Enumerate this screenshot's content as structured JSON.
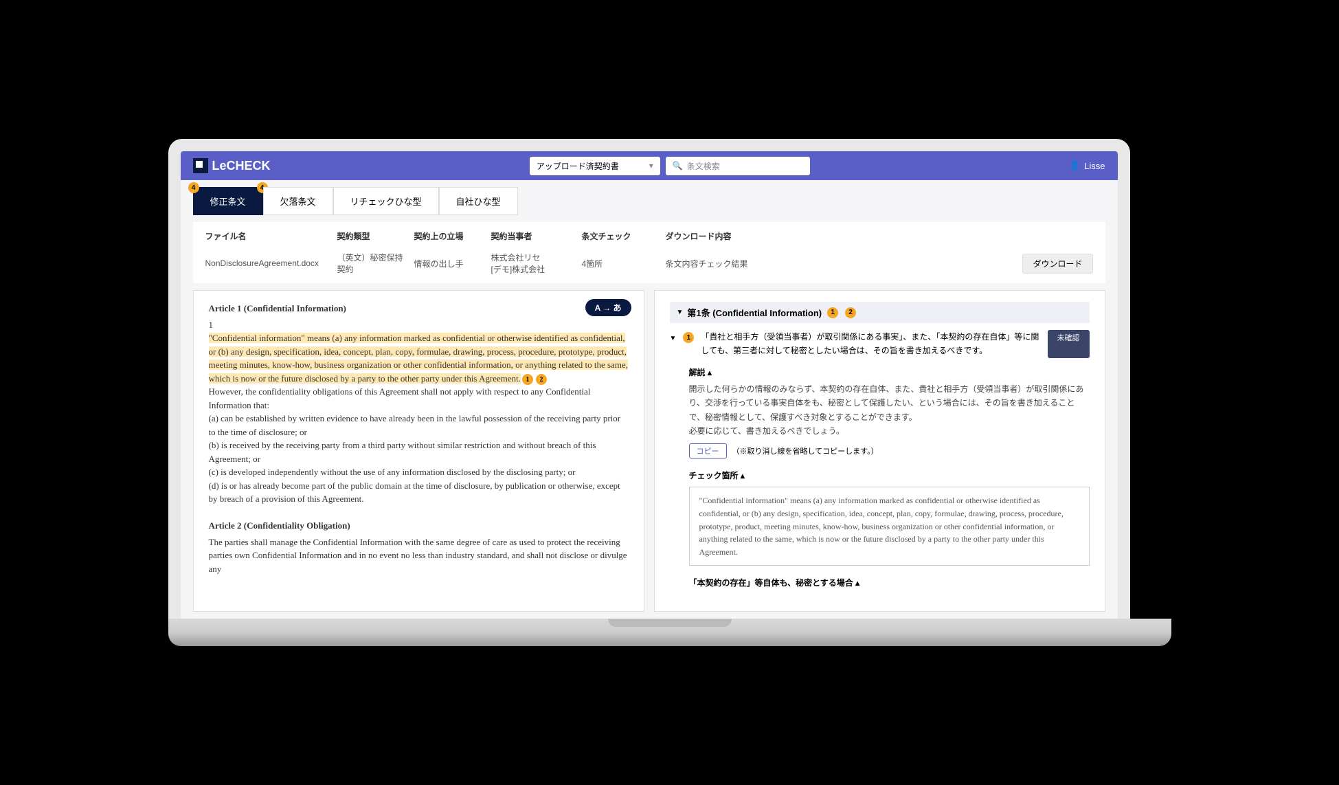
{
  "header": {
    "brand": "LeCHECK",
    "dropdown_label": "アップロード済契約書",
    "search_placeholder": "条文検索",
    "user": "Lisse"
  },
  "tabs": {
    "badge1": "4",
    "badge2": "4",
    "t1": "修正条文",
    "t2": "欠落条文",
    "t3": "リチェックひな型",
    "t4": "自社ひな型"
  },
  "file": {
    "headers": {
      "name": "ファイル名",
      "type": "契約類型",
      "position": "契約上の立場",
      "parties": "契約当事者",
      "check": "条文チェック",
      "download_content": "ダウンロード内容"
    },
    "row": {
      "name": "NonDisclosureAgreement.docx",
      "type": "（英文）秘密保持契約",
      "position": "情報の出し手",
      "parties": "株式会社リセ\n[デモ]株式会社",
      "check": "4箇所",
      "download_content": "条文内容チェック結果",
      "download_btn": "ダウンロード"
    }
  },
  "doc": {
    "toggle": "A → あ",
    "article1_title": "Article 1 (Confidential Information)",
    "one": "1",
    "hl": "\"Confidential information\" means (a) any information marked as confidential or otherwise identified as confidential, or (b) any design, specification, idea, concept, plan, copy, formulae, drawing, process, procedure, prototype, product, meeting minutes, know-how, business organization or other confidential information, or anything related to the same, which is now or the future disclosed by a party to the other party under this Agreement.",
    "b1": "1",
    "b2": "2",
    "p2": "However, the confidentiality obligations of this Agreement shall not apply with respect to any Confidential Information that:",
    "pa": "(a) can be established by written evidence to have already been in the lawful possession of the receiving party prior to the time of disclosure; or",
    "pb": "(b) is received by the receiving party from a third party without similar restriction and without breach of this Agreement; or",
    "pc": "(c) is developed independently without the use of any information disclosed by the disclosing party; or",
    "pd": "(d) is or has already become part of the public domain at the time of disclosure, by publication or otherwise, except by breach of a provision of this Agreement.",
    "article2_title": "Article 2 (Confidentiality Obligation)",
    "article2_body": "The parties shall manage the Confidential Information with the same degree of care as used to protect the receiving parties own Confidential Information and in no event no less than industry standard, and shall not disclose or divulge any"
  },
  "review": {
    "section_title": "第1条 (Confidential Information)",
    "sb1": "1",
    "sb2": "2",
    "item1_badge": "1",
    "item1_text": "「貴社と相手方（受領当事者）が取引関係にある事実」、また、「本契約の存在自体」等に関しても、第三者に対して秘密としたい場合は、その旨を書き加えるべきです。",
    "status": "未確認",
    "explain_label": "解説 ▴",
    "explain_text": "開示した何らかの情報のみならず、本契約の存在自体、また、貴社と相手方（受領当事者）が取引関係にあり、交渉を行っている事実自体をも、秘密として保護したい、という場合には、その旨を書き加えることで、秘密情報として、保護すべき対象とすることができます。\n必要に応じて、書き加えるべきでしょう。",
    "copy_btn": "コピー",
    "copy_note": "（※取り消し線を省略してコピーします。）",
    "check_location_label": "チェック箇所 ▴",
    "quoted_text": "\"Confidential information\" means (a) any information marked as confidential or otherwise identified as confidential, or (b) any design, specification, idea, concept, plan, copy, formulae, drawing, process, procedure, prototype, product, meeting minutes, know-how, business organization or other confidential information, or anything related to the same, which is now or the future disclosed by a party to the other party under this Agreement.",
    "footer_section": "「本契約の存在」等自体も、秘密とする場合 ▴"
  }
}
